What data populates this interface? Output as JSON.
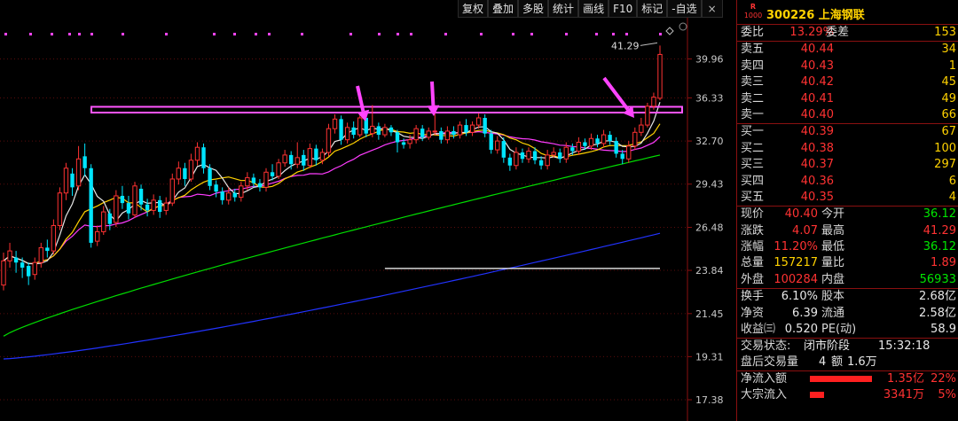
{
  "toolbar": [
    "复权",
    "叠加",
    "多股",
    "统计",
    "画线",
    "F10",
    "标记",
    "-自选",
    "×"
  ],
  "stock": {
    "logo_top": "R",
    "logo_bottom": "1000",
    "code_name": "300226 上海钢联"
  },
  "weibi": {
    "label1": "委比",
    "value1": "13.29%",
    "label2": "委差",
    "value2": "153"
  },
  "sell": [
    {
      "label": "卖五",
      "price": "40.44",
      "vol": "34"
    },
    {
      "label": "卖四",
      "price": "40.43",
      "vol": "1"
    },
    {
      "label": "卖三",
      "price": "40.42",
      "vol": "45"
    },
    {
      "label": "卖二",
      "price": "40.41",
      "vol": "49"
    },
    {
      "label": "卖一",
      "price": "40.40",
      "vol": "66"
    }
  ],
  "buy": [
    {
      "label": "买一",
      "price": "40.39",
      "vol": "67"
    },
    {
      "label": "买二",
      "price": "40.38",
      "vol": "100"
    },
    {
      "label": "买三",
      "price": "40.37",
      "vol": "297"
    },
    {
      "label": "买四",
      "price": "40.36",
      "vol": "6"
    },
    {
      "label": "买五",
      "price": "40.35",
      "vol": "4"
    }
  ],
  "quote1": [
    {
      "l1": "现价",
      "v1": "40.40",
      "c1": "red",
      "l2": "今开",
      "v2": "36.12",
      "c2": "green"
    },
    {
      "l1": "涨跌",
      "v1": "4.07",
      "c1": "red",
      "l2": "最高",
      "v2": "41.29",
      "c2": "red"
    },
    {
      "l1": "涨幅",
      "v1": "11.20%",
      "c1": "red",
      "l2": "最低",
      "v2": "36.12",
      "c2": "green"
    },
    {
      "l1": "总量",
      "v1": "157217",
      "c1": "yellow",
      "l2": "量比",
      "v2": "1.89",
      "c2": "red"
    },
    {
      "l1": "外盘",
      "v1": "100284",
      "c1": "red",
      "l2": "内盘",
      "v2": "56933",
      "c2": "green"
    }
  ],
  "quote2": [
    {
      "l1": "换手",
      "v1": "6.10%",
      "c1": "white",
      "l2": "股本",
      "v2": "2.68亿",
      "c2": "white"
    },
    {
      "l1": "净资",
      "v1": "6.39",
      "c1": "white",
      "l2": "流通",
      "v2": "2.58亿",
      "c2": "white"
    },
    {
      "l1": "收益㈢",
      "v1": "0.520",
      "c1": "white",
      "l2": "PE(动)",
      "v2": "58.9",
      "c2": "white"
    }
  ],
  "status": {
    "state_label": "交易状态:",
    "state_value": "闭市阶段",
    "time": "15:32:18",
    "after_label": "盘后交易量",
    "after_vol": "4",
    "after_amt_label": "额",
    "after_amt": "1.6万"
  },
  "flows": [
    {
      "label": "净流入额",
      "value": "1.35亿",
      "pct": "22%",
      "fill": 0.22
    },
    {
      "label": "大宗流入",
      "value": "3341万",
      "pct": "5%",
      "fill": 0.05
    }
  ],
  "chart_data": {
    "type": "candlestick",
    "y_ticks": [
      "39.96",
      "36.33",
      "32.70",
      "29.43",
      "26.48",
      "23.84",
      "21.45",
      "19.31",
      "17.38"
    ],
    "y_tick_values": [
      39.96,
      36.33,
      32.7,
      29.43,
      26.48,
      23.84,
      21.45,
      19.31,
      17.38
    ],
    "scale": "log",
    "ylim": [
      16.5,
      44.0
    ],
    "high_label": "41.29",
    "resistance_band": [
      35.05,
      35.55
    ],
    "colors": {
      "up": "#ff3232",
      "down": "#00e5ff",
      "ma5": "#e6e6e6",
      "ma10": "#ffd200",
      "ma20": "#ff3cff",
      "ma60": "#00dd00",
      "ma120": "#2233ff",
      "ma250": "#ffffff",
      "band": "#ff55ff",
      "arrow": "#ff44ff"
    },
    "candles": [
      {
        "o": 23.0,
        "c": 24.4,
        "h": 24.9,
        "l": 22.7
      },
      {
        "o": 24.4,
        "c": 25.0,
        "h": 25.5,
        "l": 24.0
      },
      {
        "o": 24.6,
        "c": 24.3,
        "h": 25.0,
        "l": 23.7
      },
      {
        "o": 24.3,
        "c": 24.0,
        "h": 24.6,
        "l": 23.4
      },
      {
        "o": 24.1,
        "c": 23.5,
        "h": 24.3,
        "l": 23.0
      },
      {
        "o": 23.6,
        "c": 24.3,
        "h": 24.6,
        "l": 23.3
      },
      {
        "o": 24.3,
        "c": 25.2,
        "h": 25.5,
        "l": 24.0
      },
      {
        "o": 25.2,
        "c": 25.0,
        "h": 25.7,
        "l": 24.6
      },
      {
        "o": 25.0,
        "c": 26.6,
        "h": 27.0,
        "l": 24.8
      },
      {
        "o": 26.6,
        "c": 28.8,
        "h": 29.2,
        "l": 26.3
      },
      {
        "o": 28.8,
        "c": 30.6,
        "h": 31.0,
        "l": 28.3
      },
      {
        "o": 30.2,
        "c": 29.2,
        "h": 30.6,
        "l": 28.6
      },
      {
        "o": 29.3,
        "c": 31.3,
        "h": 32.3,
        "l": 29.0
      },
      {
        "o": 31.5,
        "c": 30.6,
        "h": 32.5,
        "l": 30.0
      },
      {
        "o": 30.6,
        "c": 25.5,
        "h": 30.9,
        "l": 25.2
      },
      {
        "o": 25.6,
        "c": 26.2,
        "h": 26.6,
        "l": 25.3
      },
      {
        "o": 26.2,
        "c": 27.5,
        "h": 27.9,
        "l": 26.0
      },
      {
        "o": 27.4,
        "c": 26.7,
        "h": 27.7,
        "l": 26.3
      },
      {
        "o": 26.8,
        "c": 28.6,
        "h": 29.0,
        "l": 26.5
      },
      {
        "o": 28.6,
        "c": 28.1,
        "h": 29.3,
        "l": 27.7
      },
      {
        "o": 28.1,
        "c": 27.4,
        "h": 28.6,
        "l": 27.0
      },
      {
        "o": 27.3,
        "c": 29.3,
        "h": 29.6,
        "l": 27.1
      },
      {
        "o": 29.1,
        "c": 28.0,
        "h": 29.4,
        "l": 27.6
      },
      {
        "o": 28.0,
        "c": 27.6,
        "h": 28.4,
        "l": 27.2
      },
      {
        "o": 27.6,
        "c": 28.3,
        "h": 28.7,
        "l": 27.3
      },
      {
        "o": 28.3,
        "c": 27.5,
        "h": 28.6,
        "l": 27.1
      },
      {
        "o": 27.6,
        "c": 28.1,
        "h": 28.5,
        "l": 27.3
      },
      {
        "o": 28.1,
        "c": 29.8,
        "h": 30.2,
        "l": 27.9
      },
      {
        "o": 29.8,
        "c": 30.6,
        "h": 31.1,
        "l": 29.4
      },
      {
        "o": 30.6,
        "c": 29.8,
        "h": 31.0,
        "l": 29.3
      },
      {
        "o": 29.8,
        "c": 31.2,
        "h": 31.7,
        "l": 29.6
      },
      {
        "o": 31.2,
        "c": 32.2,
        "h": 32.6,
        "l": 30.8
      },
      {
        "o": 32.2,
        "c": 30.6,
        "h": 32.5,
        "l": 30.2
      },
      {
        "o": 30.6,
        "c": 29.3,
        "h": 30.9,
        "l": 29.0
      },
      {
        "o": 29.4,
        "c": 28.9,
        "h": 29.7,
        "l": 28.5
      },
      {
        "o": 28.9,
        "c": 28.3,
        "h": 29.2,
        "l": 28.0
      },
      {
        "o": 28.3,
        "c": 28.8,
        "h": 29.2,
        "l": 28.0
      },
      {
        "o": 28.8,
        "c": 28.5,
        "h": 29.1,
        "l": 28.2
      },
      {
        "o": 28.5,
        "c": 29.3,
        "h": 29.6,
        "l": 28.2
      },
      {
        "o": 29.3,
        "c": 29.9,
        "h": 30.3,
        "l": 29.0
      },
      {
        "o": 29.9,
        "c": 29.5,
        "h": 30.2,
        "l": 29.2
      },
      {
        "o": 29.5,
        "c": 29.2,
        "h": 29.8,
        "l": 28.9
      },
      {
        "o": 29.2,
        "c": 30.3,
        "h": 30.6,
        "l": 28.9
      },
      {
        "o": 30.3,
        "c": 30.0,
        "h": 30.9,
        "l": 29.7
      },
      {
        "o": 30.0,
        "c": 31.0,
        "h": 31.3,
        "l": 29.8
      },
      {
        "o": 31.0,
        "c": 31.6,
        "h": 32.0,
        "l": 30.7
      },
      {
        "o": 31.6,
        "c": 30.9,
        "h": 31.9,
        "l": 30.5
      },
      {
        "o": 30.9,
        "c": 31.4,
        "h": 32.6,
        "l": 30.6
      },
      {
        "o": 31.6,
        "c": 30.8,
        "h": 32.0,
        "l": 30.4
      },
      {
        "o": 30.8,
        "c": 32.1,
        "h": 32.5,
        "l": 30.6
      },
      {
        "o": 32.1,
        "c": 31.2,
        "h": 32.4,
        "l": 30.8
      },
      {
        "o": 31.2,
        "c": 31.8,
        "h": 32.1,
        "l": 30.9
      },
      {
        "o": 31.8,
        "c": 33.7,
        "h": 34.1,
        "l": 31.5
      },
      {
        "o": 33.7,
        "c": 34.5,
        "h": 34.9,
        "l": 33.3
      },
      {
        "o": 34.5,
        "c": 32.8,
        "h": 34.8,
        "l": 32.4
      },
      {
        "o": 32.8,
        "c": 33.8,
        "h": 34.2,
        "l": 32.5
      },
      {
        "o": 33.8,
        "c": 33.2,
        "h": 34.3,
        "l": 32.9
      },
      {
        "o": 33.2,
        "c": 34.6,
        "h": 35.0,
        "l": 33.0
      },
      {
        "o": 34.6,
        "c": 33.3,
        "h": 34.9,
        "l": 33.0
      },
      {
        "o": 33.3,
        "c": 33.9,
        "h": 35.7,
        "l": 33.0
      },
      {
        "o": 33.9,
        "c": 33.2,
        "h": 34.2,
        "l": 32.8
      },
      {
        "o": 33.2,
        "c": 33.8,
        "h": 34.1,
        "l": 33.0
      },
      {
        "o": 33.8,
        "c": 33.4,
        "h": 34.0,
        "l": 33.1
      },
      {
        "o": 33.4,
        "c": 32.6,
        "h": 33.6,
        "l": 31.8
      },
      {
        "o": 32.6,
        "c": 32.4,
        "h": 32.9,
        "l": 32.1
      },
      {
        "o": 32.5,
        "c": 32.8,
        "h": 33.2,
        "l": 32.1
      },
      {
        "o": 32.8,
        "c": 33.7,
        "h": 34.0,
        "l": 32.5
      },
      {
        "o": 33.7,
        "c": 33.0,
        "h": 34.0,
        "l": 32.7
      },
      {
        "o": 33.0,
        "c": 33.5,
        "h": 33.8,
        "l": 32.8
      },
      {
        "o": 33.5,
        "c": 33.5,
        "h": 35.7,
        "l": 33.2
      },
      {
        "o": 33.5,
        "c": 32.8,
        "h": 33.8,
        "l": 32.5
      },
      {
        "o": 32.8,
        "c": 33.5,
        "h": 33.9,
        "l": 32.5
      },
      {
        "o": 33.5,
        "c": 33.2,
        "h": 33.9,
        "l": 32.9
      },
      {
        "o": 33.2,
        "c": 34.0,
        "h": 34.3,
        "l": 32.9
      },
      {
        "o": 34.0,
        "c": 33.4,
        "h": 34.5,
        "l": 33.1
      },
      {
        "o": 33.4,
        "c": 34.0,
        "h": 34.3,
        "l": 33.1
      },
      {
        "o": 34.0,
        "c": 34.6,
        "h": 35.0,
        "l": 33.7
      },
      {
        "o": 34.6,
        "c": 33.3,
        "h": 34.9,
        "l": 33.0
      },
      {
        "o": 33.3,
        "c": 32.0,
        "h": 33.6,
        "l": 31.7
      },
      {
        "o": 32.0,
        "c": 32.7,
        "h": 33.1,
        "l": 31.7
      },
      {
        "o": 32.7,
        "c": 31.4,
        "h": 33.0,
        "l": 31.0
      },
      {
        "o": 31.4,
        "c": 30.8,
        "h": 31.7,
        "l": 30.4
      },
      {
        "o": 30.8,
        "c": 31.8,
        "h": 32.2,
        "l": 30.5
      },
      {
        "o": 31.8,
        "c": 31.3,
        "h": 32.1,
        "l": 31.0
      },
      {
        "o": 31.3,
        "c": 31.9,
        "h": 32.2,
        "l": 31.0
      },
      {
        "o": 31.9,
        "c": 31.2,
        "h": 32.2,
        "l": 30.9
      },
      {
        "o": 31.2,
        "c": 30.8,
        "h": 31.5,
        "l": 30.5
      },
      {
        "o": 30.8,
        "c": 31.6,
        "h": 32.0,
        "l": 30.5
      },
      {
        "o": 31.6,
        "c": 31.8,
        "h": 32.2,
        "l": 31.4
      },
      {
        "o": 31.8,
        "c": 31.3,
        "h": 32.1,
        "l": 31.0
      },
      {
        "o": 31.3,
        "c": 32.2,
        "h": 32.6,
        "l": 31.0
      },
      {
        "o": 32.2,
        "c": 31.9,
        "h": 32.5,
        "l": 31.6
      },
      {
        "o": 31.9,
        "c": 32.6,
        "h": 33.0,
        "l": 31.6
      },
      {
        "o": 32.6,
        "c": 32.3,
        "h": 32.9,
        "l": 32.0
      },
      {
        "o": 32.3,
        "c": 32.9,
        "h": 33.3,
        "l": 32.0
      },
      {
        "o": 32.9,
        "c": 32.5,
        "h": 33.2,
        "l": 32.2
      },
      {
        "o": 32.5,
        "c": 33.2,
        "h": 33.6,
        "l": 32.2
      },
      {
        "o": 33.2,
        "c": 32.7,
        "h": 33.5,
        "l": 32.4
      },
      {
        "o": 32.7,
        "c": 31.7,
        "h": 33.0,
        "l": 31.4
      },
      {
        "o": 31.7,
        "c": 31.3,
        "h": 32.0,
        "l": 30.9
      },
      {
        "o": 31.3,
        "c": 32.3,
        "h": 32.7,
        "l": 31.0
      },
      {
        "o": 32.3,
        "c": 33.4,
        "h": 33.8,
        "l": 32.0
      },
      {
        "o": 33.4,
        "c": 34.0,
        "h": 34.6,
        "l": 33.1
      },
      {
        "o": 34.0,
        "c": 35.6,
        "h": 35.9,
        "l": 33.8
      },
      {
        "o": 35.6,
        "c": 36.4,
        "h": 36.8,
        "l": 35.3
      },
      {
        "o": 36.3,
        "c": 40.4,
        "h": 41.29,
        "l": 36.12
      }
    ]
  }
}
